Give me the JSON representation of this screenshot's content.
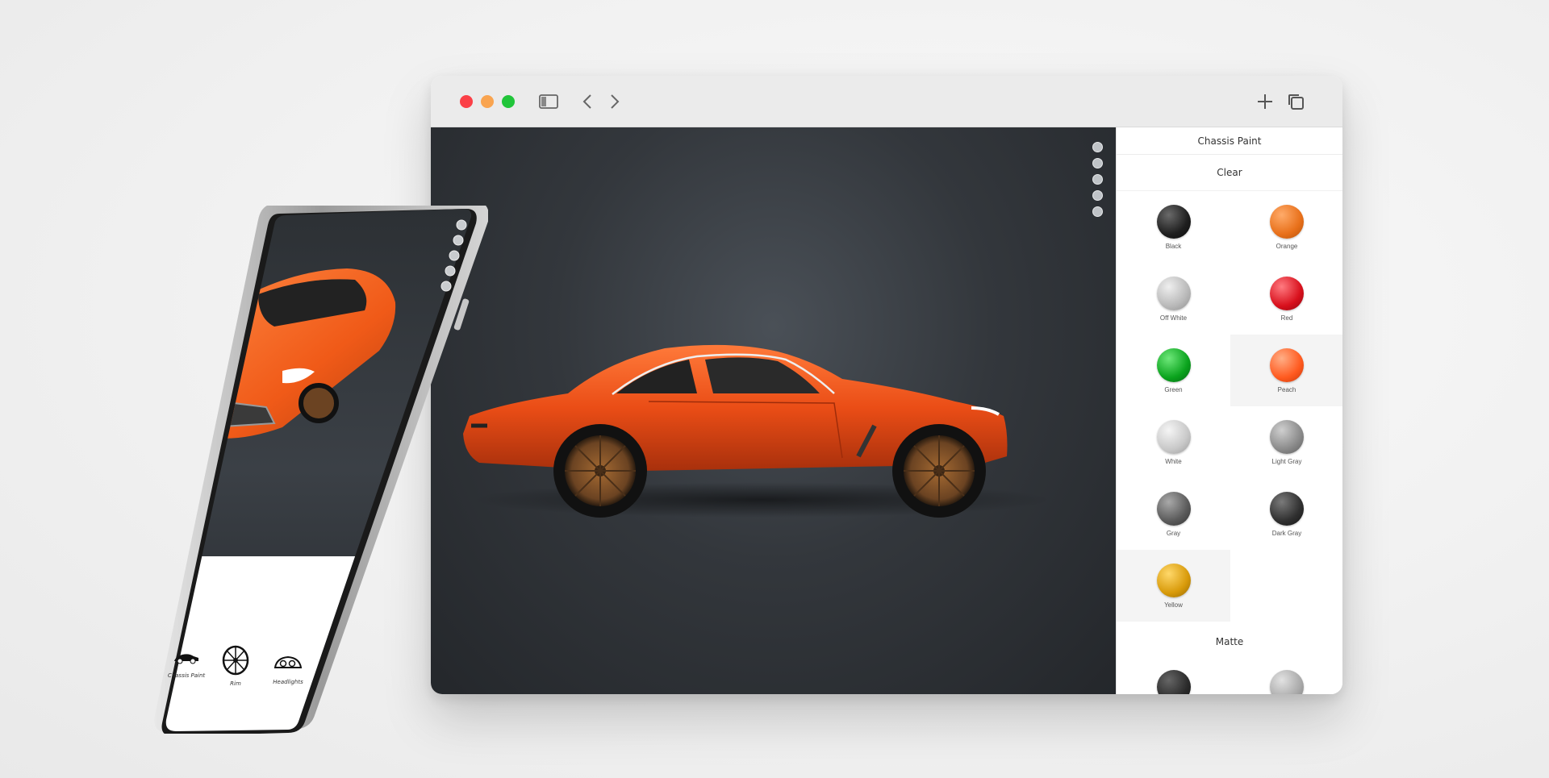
{
  "browser": {
    "controls": [
      "close",
      "minimize",
      "zoom"
    ],
    "toolbar_icons": [
      "sidebar-icon",
      "chevron-left-icon",
      "chevron-right-icon",
      "plus-icon",
      "tabs-icon"
    ]
  },
  "viewer": {
    "tool_buttons": [
      "reset-view-icon",
      "rotate-icon",
      "fullscreen-icon",
      "info-icon",
      "settings-icon"
    ]
  },
  "panel": {
    "title": "Chassis Paint",
    "sections": [
      {
        "title": "Clear",
        "swatches": [
          {
            "label": "Black",
            "color": "#1e1e1e",
            "selected": false
          },
          {
            "label": "Orange",
            "color": "#e8701a",
            "selected": false
          },
          {
            "label": "Off White",
            "color": "#b9b9b9",
            "selected": false
          },
          {
            "label": "Red",
            "color": "#d8101c",
            "selected": false
          },
          {
            "label": "Green",
            "color": "#0aa31d",
            "selected": false
          },
          {
            "label": "Peach",
            "color": "#ff5a1f",
            "selected": true
          },
          {
            "label": "White",
            "color": "#c8c8c8",
            "selected": false
          },
          {
            "label": "Light Gray",
            "color": "#8a8a8a",
            "selected": false
          },
          {
            "label": "Gray",
            "color": "#5a5a5a",
            "selected": false
          },
          {
            "label": "Dark Gray",
            "color": "#2f2f2f",
            "selected": false
          },
          {
            "label": "Yellow",
            "color": "#d89a0a",
            "selected": true
          }
        ]
      },
      {
        "title": "Matte",
        "swatches": [
          {
            "label": "",
            "color": "#2a2a2a"
          },
          {
            "label": "",
            "color": "#a9a9a9"
          }
        ]
      }
    ]
  },
  "phone": {
    "nav": [
      {
        "label": "Chassis Paint",
        "icon": "car-icon"
      },
      {
        "label": "Rim",
        "icon": "wheel-icon"
      },
      {
        "label": "Headlights",
        "icon": "headlight-icon"
      }
    ]
  },
  "colors": {
    "car_body": "#f2541b",
    "viewer_bg": "#2b2f33",
    "rim": "#8a5a2e"
  }
}
